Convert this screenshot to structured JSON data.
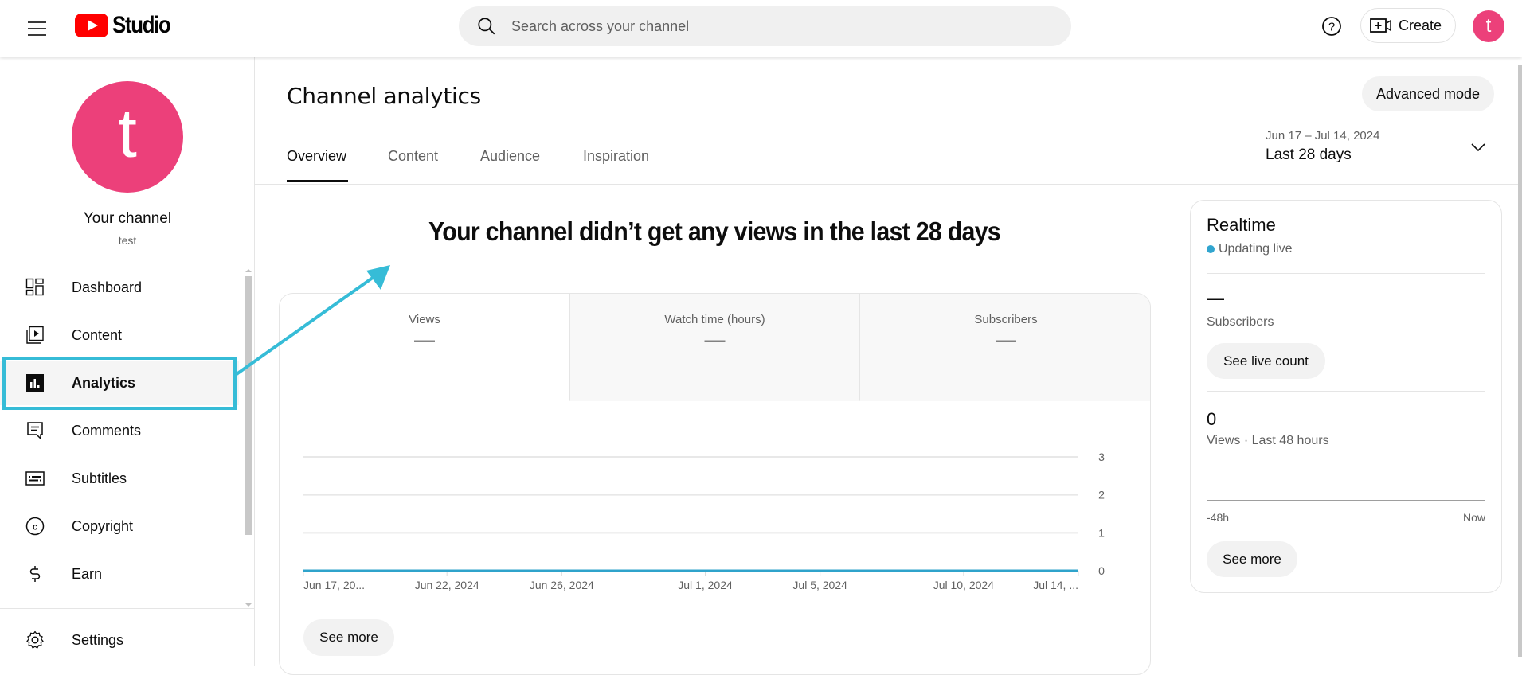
{
  "header": {
    "app_name": "Studio",
    "search_placeholder": "Search across your channel",
    "create_label": "Create",
    "avatar_letter": "t",
    "icons": {
      "menu": "hamburger-menu-icon",
      "search": "search-icon",
      "help": "help-circle-icon",
      "create": "video-plus-icon"
    }
  },
  "sidebar": {
    "avatar_letter": "t",
    "channel_title": "Your channel",
    "channel_handle": "test",
    "items": [
      {
        "label": "Dashboard",
        "icon": "dashboard-icon",
        "active": false
      },
      {
        "label": "Content",
        "icon": "content-icon",
        "active": false
      },
      {
        "label": "Analytics",
        "icon": "analytics-icon",
        "active": true
      },
      {
        "label": "Comments",
        "icon": "comments-icon",
        "active": false
      },
      {
        "label": "Subtitles",
        "icon": "subtitles-icon",
        "active": false
      },
      {
        "label": "Copyright",
        "icon": "copyright-icon",
        "active": false
      },
      {
        "label": "Earn",
        "icon": "dollar-icon",
        "active": false
      }
    ],
    "settings_label": "Settings"
  },
  "main": {
    "title": "Channel analytics",
    "advanced_mode_label": "Advanced mode",
    "tabs": [
      {
        "label": "Overview",
        "active": true
      },
      {
        "label": "Content",
        "active": false
      },
      {
        "label": "Audience",
        "active": false
      },
      {
        "label": "Inspiration",
        "active": false
      }
    ],
    "date_range": "Jun 17 – Jul 14, 2024",
    "date_preset": "Last 28 days",
    "headline": "Your channel didn’t get any views in the last 28 days",
    "metrics": [
      {
        "label": "Views",
        "value": "—",
        "selected": true
      },
      {
        "label": "Watch time (hours)",
        "value": "—",
        "selected": false
      },
      {
        "label": "Subscribers",
        "value": "—",
        "selected": false
      }
    ],
    "see_more_label": "See more"
  },
  "chart_data": {
    "type": "line",
    "title": "",
    "xlabel": "",
    "ylabel": "Views",
    "x_tick_labels": [
      "Jun 17, 20...",
      "Jun 22, 2024",
      "Jun 26, 2024",
      "Jul 1, 2024",
      "Jul 5, 2024",
      "Jul 10, 2024",
      "Jul 14, ..."
    ],
    "x_tick_day_index": [
      0,
      5,
      9,
      14,
      18,
      23,
      27
    ],
    "y_ticks": [
      0,
      1,
      2,
      3
    ],
    "ylim": [
      0,
      3
    ],
    "grid": true,
    "series": [
      {
        "name": "Views",
        "color": "#2fa3cb",
        "values": [
          0,
          0,
          0,
          0,
          0,
          0,
          0,
          0,
          0,
          0,
          0,
          0,
          0,
          0,
          0,
          0,
          0,
          0,
          0,
          0,
          0,
          0,
          0,
          0,
          0,
          0,
          0,
          0
        ]
      }
    ]
  },
  "realtime": {
    "title": "Realtime",
    "status": "Updating live",
    "subscribers_value": "—",
    "subscribers_label": "Subscribers",
    "see_live_count_label": "See live count",
    "views_value": "0",
    "views_label": "Views · Last 48 hours",
    "axis_start": "-48h",
    "axis_end": "Now",
    "see_more_label": "See more"
  },
  "colors": {
    "brand_red": "#ff0000",
    "avatar_pink": "#ec407a",
    "annotation_cyan": "#36bcd7",
    "live_dot": "#31a5cf"
  }
}
